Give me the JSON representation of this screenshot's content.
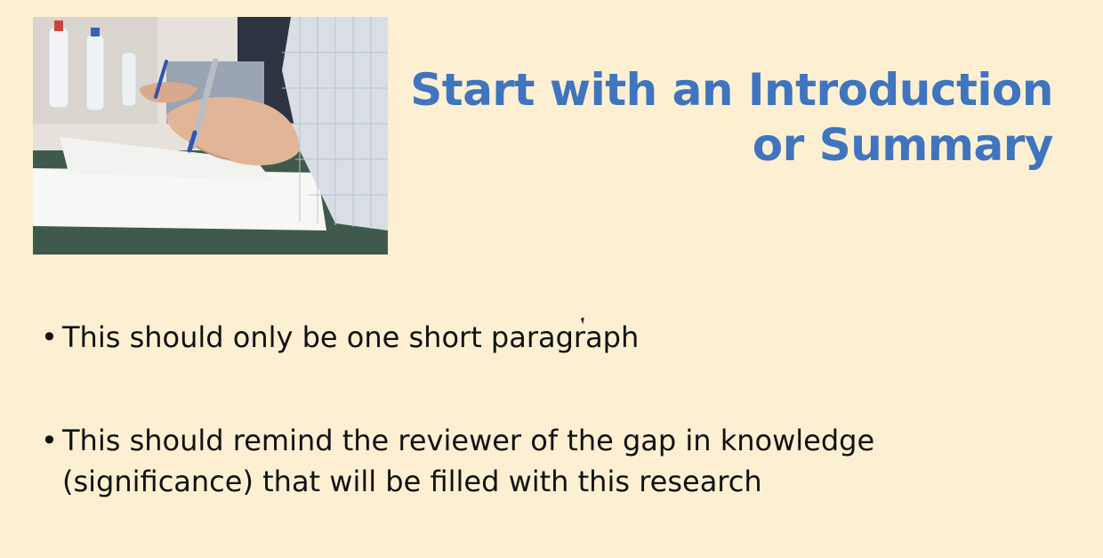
{
  "slide": {
    "title_lines": [
      "Start with an Introduction",
      "or Summary"
    ],
    "bullets": [
      "This should only be one short paragraph",
      "This should remind the reviewer of the gap in knowledge (significance) that will be filled with this research"
    ],
    "bullet_glyph": "•",
    "photo": {
      "icon": "writing-photo"
    },
    "colors": {
      "background": "#fdf0d2",
      "title": "#3f74bf",
      "body_text": "#111111"
    }
  }
}
